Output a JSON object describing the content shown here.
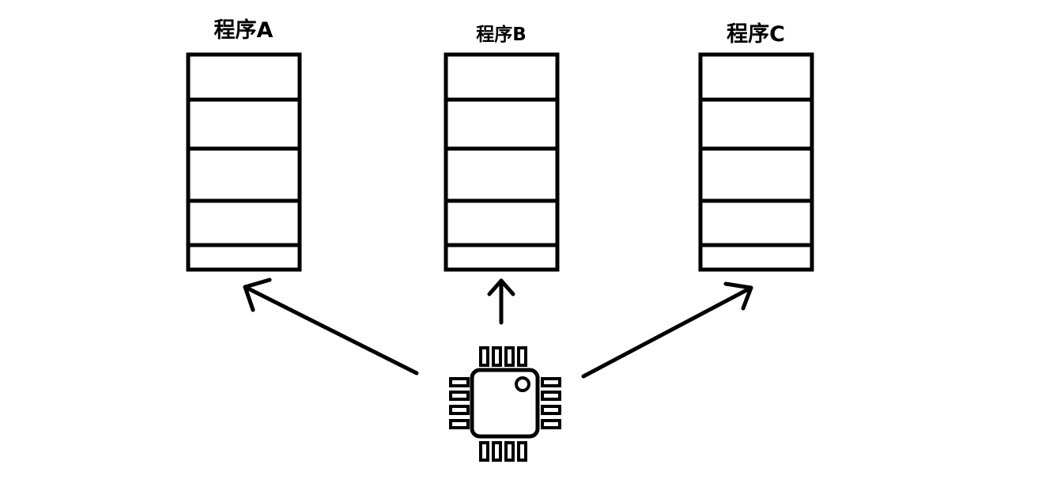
{
  "programs": [
    {
      "label": "程序A"
    },
    {
      "label": "程序B"
    },
    {
      "label": "程序C"
    }
  ],
  "colors": {
    "stroke": "#000000",
    "background": "#ffffff"
  },
  "icons": {
    "cpu": "cpu-chip-icon"
  }
}
